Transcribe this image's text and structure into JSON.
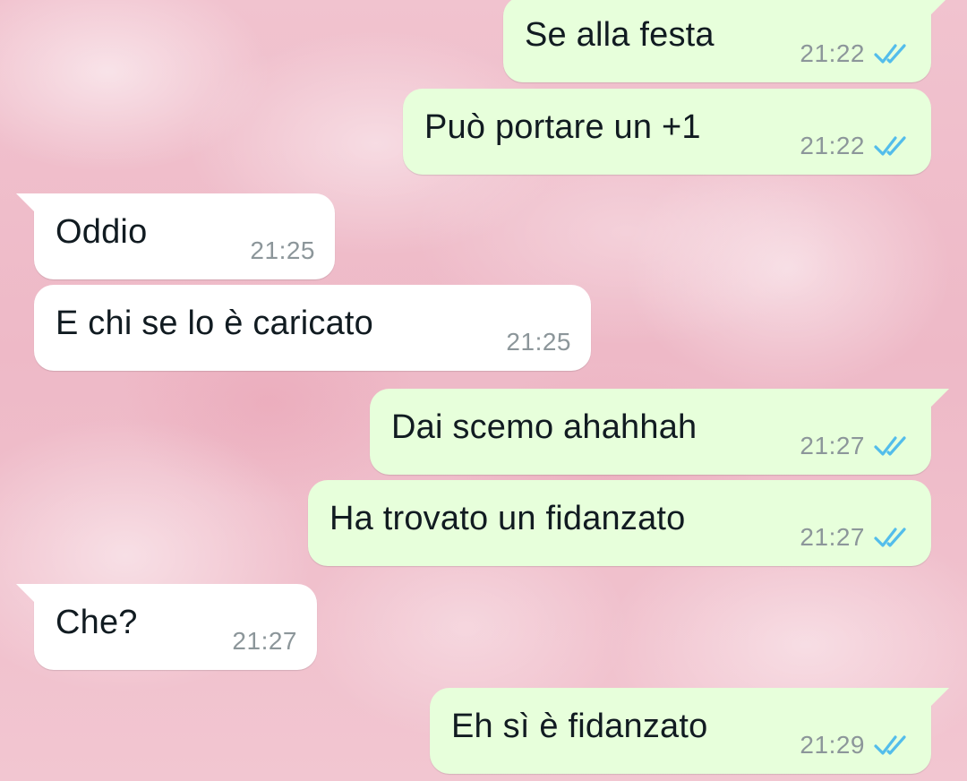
{
  "chat": {
    "messages": [
      {
        "text": "Se alla festa",
        "time": "21:22",
        "direction": "outgoing",
        "status": "read"
      },
      {
        "text": "Può portare un +1",
        "time": "21:22",
        "direction": "outgoing",
        "status": "read"
      },
      {
        "text": "Oddio",
        "time": "21:25",
        "direction": "incoming"
      },
      {
        "text": "E chi se lo è caricato",
        "time": "21:25",
        "direction": "incoming"
      },
      {
        "text": "Dai scemo ahahhah",
        "time": "21:27",
        "direction": "outgoing",
        "status": "read"
      },
      {
        "text": "Ha trovato un fidanzato",
        "time": "21:27",
        "direction": "outgoing",
        "status": "read"
      },
      {
        "text": "Che?",
        "time": "21:27",
        "direction": "incoming"
      },
      {
        "text": "Eh sì è fidanzato",
        "time": "21:29",
        "direction": "outgoing",
        "status": "read"
      }
    ]
  },
  "icons": {
    "read_receipt": "double-check-icon"
  },
  "colors": {
    "outgoing_bubble": "#e7ffdb",
    "incoming_bubble": "#ffffff",
    "read_tick": "#53bdeb",
    "timestamp": "#8c969a",
    "message_text": "#111b21",
    "wallpaper": "#f1c3cf"
  }
}
